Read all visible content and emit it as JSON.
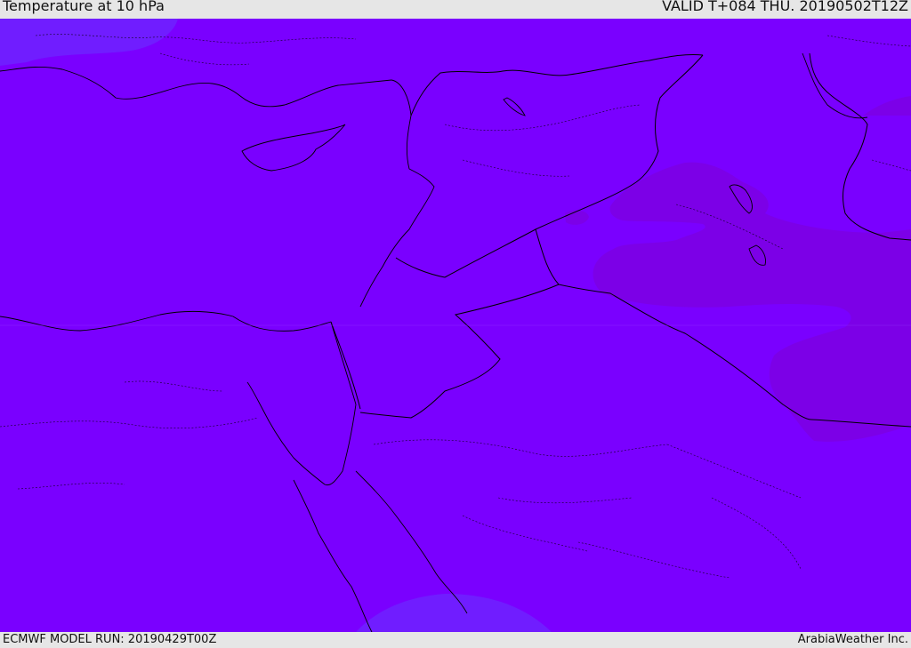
{
  "header": {
    "title": "Temperature at 10 hPa",
    "valid": "VALID T+084 THU. 20190502T12Z"
  },
  "footer": {
    "model_run": "ECMWF MODEL RUN: 20190429T00Z",
    "brand": "ArabiaWeather Inc."
  },
  "colors": {
    "base_field": "#7a00ff",
    "warm_field": "#7c00e6",
    "cool_field": "#6e22ff",
    "bar_background": "#e6e6e6",
    "boundary_line": "#000000"
  }
}
